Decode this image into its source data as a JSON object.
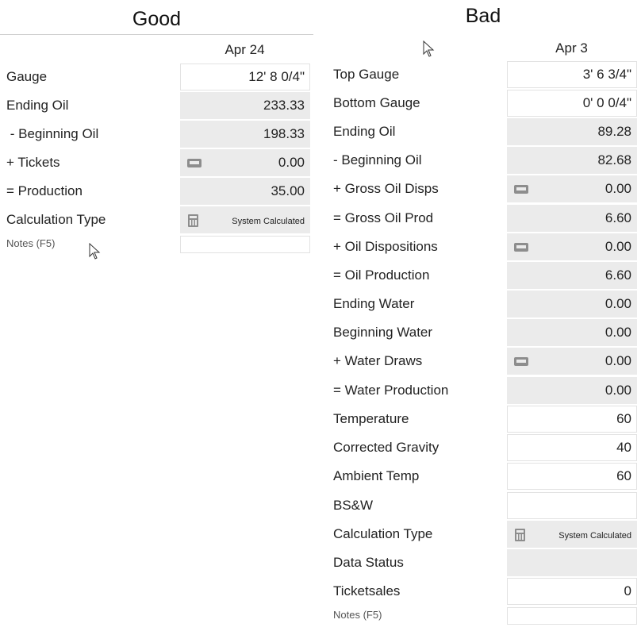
{
  "good": {
    "title": "Good",
    "date": "Apr 24",
    "rows": [
      {
        "label": "Gauge",
        "value": "12' 8 0/4\""
      },
      {
        "label": "Ending Oil",
        "value": "233.33"
      },
      {
        "label": " - Beginning Oil",
        "value": "198.33"
      },
      {
        "label": "+ Tickets",
        "value": "0.00",
        "icon": "ticket-icon"
      },
      {
        "label": "= Production",
        "value": "35.00"
      },
      {
        "label": "Calculation Type",
        "value": "System Calculated",
        "icon": "calculator-icon"
      }
    ],
    "notes_label": "Notes (F5)",
    "notes_value": ""
  },
  "bad": {
    "title": "Bad",
    "date": "Apr 3",
    "rows": [
      {
        "label": "Top Gauge",
        "value": "3' 6 3/4\""
      },
      {
        "label": "Bottom Gauge",
        "value": "0' 0 0/4\""
      },
      {
        "label": "Ending Oil",
        "value": "89.28"
      },
      {
        "label": "- Beginning Oil",
        "value": "82.68"
      },
      {
        "label": "+ Gross Oil Disps",
        "value": "0.00",
        "icon": "ticket-icon"
      },
      {
        "label": "= Gross Oil Prod",
        "value": "6.60"
      },
      {
        "label": "+ Oil Dispositions",
        "value": "0.00",
        "icon": "ticket-icon"
      },
      {
        "label": "= Oil Production",
        "value": "6.60"
      },
      {
        "label": "Ending Water",
        "value": "0.00"
      },
      {
        "label": "Beginning Water",
        "value": "0.00"
      },
      {
        "label": "+ Water Draws",
        "value": "0.00",
        "icon": "ticket-icon"
      },
      {
        "label": "= Water Production",
        "value": "0.00"
      },
      {
        "label": "Temperature",
        "value": "60"
      },
      {
        "label": "Corrected Gravity",
        "value": "40"
      },
      {
        "label": "Ambient Temp",
        "value": "60"
      },
      {
        "label": "BS&W",
        "value": ""
      },
      {
        "label": "Calculation Type",
        "value": "System Calculated",
        "icon": "calculator-icon"
      },
      {
        "label": "Data Status",
        "value": ""
      },
      {
        "label": "Ticketsales",
        "value": "0"
      }
    ],
    "notes_label": "Notes (F5)",
    "notes_value": ""
  }
}
